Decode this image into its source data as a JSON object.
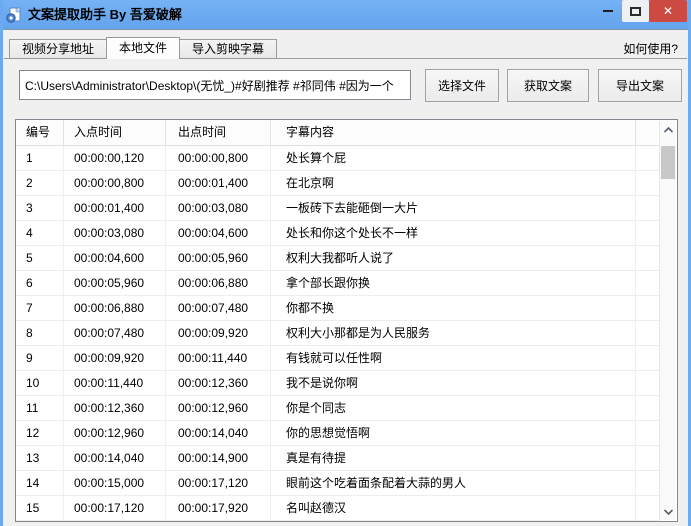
{
  "window": {
    "title": "文案提取助手 By 吾爱破解"
  },
  "icons": {
    "app": "app-logo",
    "minimize": "minus-bar",
    "maximize": "square-outline",
    "close": "✕",
    "scroll_up": "chevron-up",
    "scroll_down": "chevron-down"
  },
  "help_link": "如何使用?",
  "tabs": [
    {
      "label": "视频分享地址",
      "active": false
    },
    {
      "label": "本地文件",
      "active": true
    },
    {
      "label": "导入剪映字幕",
      "active": false
    }
  ],
  "file_section": {
    "path_value": "C:\\Users\\Administrator\\Desktop\\(无忧_)#好剧推荐 #祁同伟 #因为一个",
    "select_button": "选择文件",
    "extract_button": "获取文案",
    "export_button": "导出文案"
  },
  "table": {
    "headers": [
      "编号",
      "入点时间",
      "出点时间",
      "字幕内容"
    ],
    "rows": [
      {
        "no": "1",
        "start": "00:00:00,120",
        "end": "00:00:00,800",
        "text": "处长算个屁"
      },
      {
        "no": "2",
        "start": "00:00:00,800",
        "end": "00:00:01,400",
        "text": "在北京啊"
      },
      {
        "no": "3",
        "start": "00:00:01,400",
        "end": "00:00:03,080",
        "text": "一板砖下去能砸倒一大片"
      },
      {
        "no": "4",
        "start": "00:00:03,080",
        "end": "00:00:04,600",
        "text": "处长和你这个处长不一样"
      },
      {
        "no": "5",
        "start": "00:00:04,600",
        "end": "00:00:05,960",
        "text": "权利大我都听人说了"
      },
      {
        "no": "6",
        "start": "00:00:05,960",
        "end": "00:00:06,880",
        "text": "拿个部长跟你换"
      },
      {
        "no": "7",
        "start": "00:00:06,880",
        "end": "00:00:07,480",
        "text": "你都不换"
      },
      {
        "no": "8",
        "start": "00:00:07,480",
        "end": "00:00:09,920",
        "text": "权利大小那都是为人民服务"
      },
      {
        "no": "9",
        "start": "00:00:09,920",
        "end": "00:00:11,440",
        "text": "有钱就可以任性啊"
      },
      {
        "no": "10",
        "start": "00:00:11,440",
        "end": "00:00:12,360",
        "text": "我不是说你啊"
      },
      {
        "no": "11",
        "start": "00:00:12,360",
        "end": "00:00:12,960",
        "text": "你是个同志"
      },
      {
        "no": "12",
        "start": "00:00:12,960",
        "end": "00:00:14,040",
        "text": "你的思想觉悟啊"
      },
      {
        "no": "13",
        "start": "00:00:14,040",
        "end": "00:00:14,900",
        "text": "真是有待提"
      },
      {
        "no": "14",
        "start": "00:00:15,000",
        "end": "00:00:17,120",
        "text": "眼前这个吃着面条配着大蒜的男人"
      },
      {
        "no": "15",
        "start": "00:00:17,120",
        "end": "00:00:17,920",
        "text": "名叫赵德汉"
      }
    ]
  },
  "colors": {
    "titlebar_blue": "#6aaaf0",
    "window_border": "#6aaaf0",
    "close_red": "#cd4a42",
    "client_bg": "#f0f0f0",
    "table_border": "#828790"
  }
}
